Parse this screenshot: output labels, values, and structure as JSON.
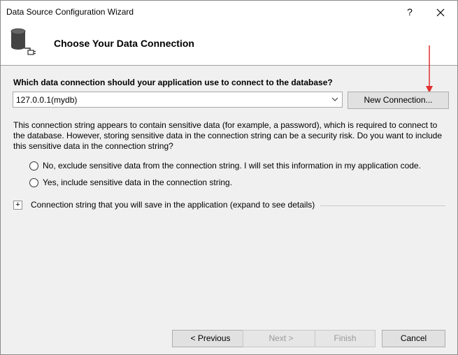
{
  "window": {
    "title": "Data Source Configuration Wizard",
    "help_label": "?",
    "close_label": "✕"
  },
  "header": {
    "title": "Choose Your Data Connection",
    "icon": "database-icon"
  },
  "connection": {
    "question": "Which data connection should your application use to connect to the database?",
    "selected": "127.0.0.1(mydb)",
    "new_connection_label": "New Connection..."
  },
  "sensitive": {
    "description": "This connection string appears to contain sensitive data (for example, a password), which is required to connect to the database. However, storing sensitive data in the connection string can be a security risk. Do you want to include this sensitive data in the connection string?",
    "option_no": "No, exclude sensitive data from the connection string. I will set this information in my application code.",
    "option_yes": "Yes, include sensitive data in the connection string."
  },
  "expander": {
    "symbol": "+",
    "label": "Connection string that you will save in the application (expand to see details)"
  },
  "footer": {
    "previous": "< Previous",
    "next": "Next >",
    "finish": "Finish",
    "cancel": "Cancel"
  },
  "colors": {
    "annotation_arrow": "#e03030"
  }
}
